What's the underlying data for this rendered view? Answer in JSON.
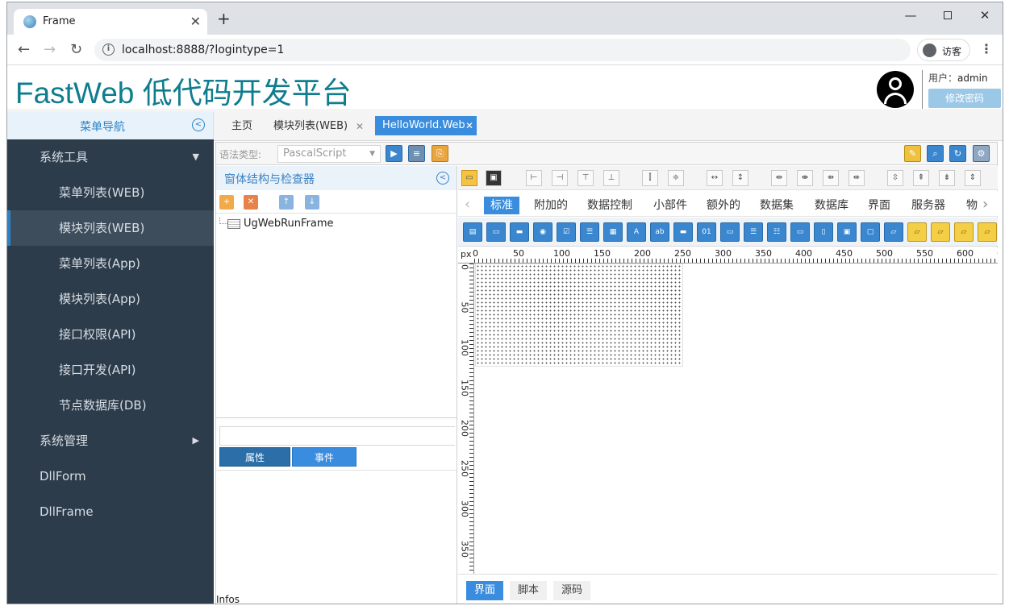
{
  "browser": {
    "tab_title": "Frame",
    "tab_close": "✕",
    "new_tab": "+",
    "url": "localhost:8888/?logintype=1",
    "profile_label": "访客",
    "min": "—",
    "close": "✕"
  },
  "header": {
    "title": "FastWeb 低代码开发平台",
    "user_prefix": "用户：",
    "user_name": "admin",
    "change_password": "修改密码"
  },
  "sidebar": {
    "title": "菜单导航",
    "items": [
      {
        "label": "系统工具",
        "level": 1,
        "caret": "▼"
      },
      {
        "label": "菜单列表(WEB)",
        "level": 2
      },
      {
        "label": "模块列表(WEB)",
        "level": 2,
        "active": true
      },
      {
        "label": "菜单列表(App)",
        "level": 2
      },
      {
        "label": "模块列表(App)",
        "level": 2
      },
      {
        "label": "接口权限(API)",
        "level": 2
      },
      {
        "label": "接口开发(API)",
        "level": 2
      },
      {
        "label": "节点数据库(DB)",
        "level": 2
      },
      {
        "label": "系统管理",
        "level": 1,
        "caret": "▶"
      },
      {
        "label": "DllForm",
        "level": 1
      },
      {
        "label": "DllFrame",
        "level": 1
      }
    ]
  },
  "content_tabs": {
    "home": "主页",
    "module_list": "模块列表(WEB)",
    "module_close": "✕",
    "hello": "HelloWorld.Web",
    "hello_close": "✕"
  },
  "designer": {
    "syntax_label": "语法类型:",
    "syntax_value": "PascalScript",
    "panel_title": "窗体结构与检查器",
    "tree_node": "UgWebRunFrame",
    "props_tab": "属性",
    "events_tab": "事件",
    "infos": "Infos",
    "palette_tabs": [
      "标准",
      "附加的",
      "数据控制",
      "小部件",
      "额外的",
      "数据集",
      "数据库",
      "界面",
      "服务器",
      "物"
    ],
    "ruler_unit": "px",
    "ruler_h": [
      "0",
      "50",
      "100",
      "150",
      "200",
      "250",
      "300",
      "350",
      "400",
      "450",
      "500",
      "550",
      "600",
      "6"
    ],
    "ruler_v": [
      "0",
      "50",
      "100",
      "150",
      "200",
      "250",
      "300",
      "350"
    ],
    "bottom_tabs": [
      "界面",
      "脚本",
      "源码"
    ]
  },
  "colors": {
    "accent": "#3a8dde",
    "title": "#0f7d8e",
    "sidebar_bg": "#2d3c4b"
  }
}
